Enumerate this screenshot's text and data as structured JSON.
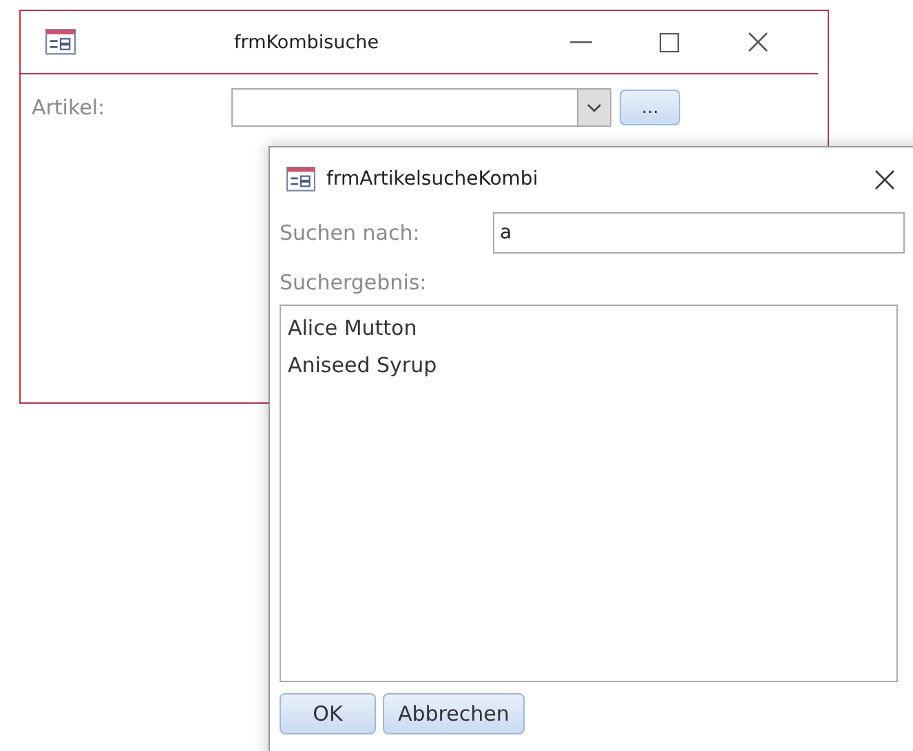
{
  "main_window": {
    "title": "frmKombisuche",
    "field_label": "Artikel:",
    "browse_button": "..."
  },
  "dialog": {
    "title": "frmArtikelsucheKombi",
    "search_label": "Suchen nach:",
    "search_value": "a",
    "results_label": "Suchergebnis:",
    "results": [
      {
        "label": "Alice Mutton",
        "selected": false
      },
      {
        "label": "Aniseed Syrup",
        "selected": false
      }
    ],
    "buttons": [
      "OK",
      "Abbrechen"
    ]
  }
}
